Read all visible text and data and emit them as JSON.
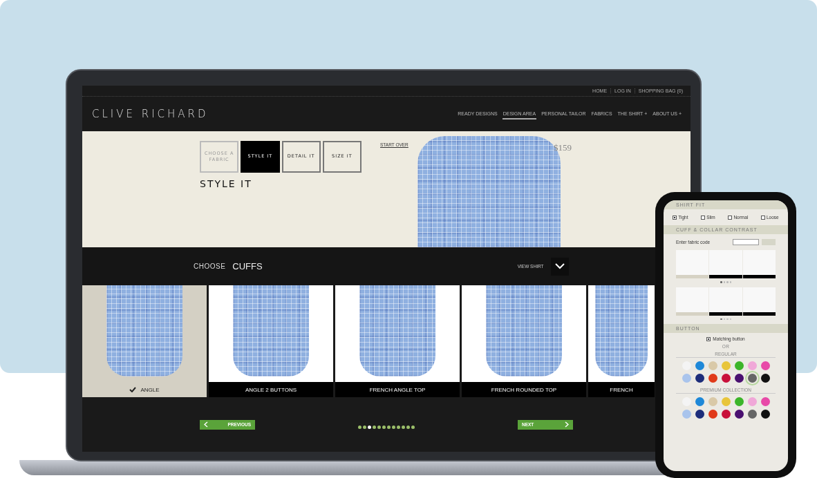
{
  "laptop": {
    "top_links": [
      "HOME",
      "LOG IN",
      "SHOPPING BAG (0)"
    ],
    "logo": "CLIVE RICHARD",
    "nav": [
      {
        "label": "READY DESIGNS",
        "selected": false
      },
      {
        "label": "DESIGN AREA",
        "selected": true
      },
      {
        "label": "PERSONAL TAILOR",
        "selected": false
      },
      {
        "label": "FABRICS",
        "selected": false
      },
      {
        "label": "THE SHIRT +",
        "selected": false
      },
      {
        "label": "ABOUT US +",
        "selected": false
      }
    ],
    "steps": [
      {
        "label": "CHOOSE A FABRIC",
        "selected": false,
        "disabled": true
      },
      {
        "label": "STYLE IT",
        "selected": true,
        "disabled": false
      },
      {
        "label": "DETAIL IT",
        "selected": false,
        "disabled": false
      },
      {
        "label": "SIZE IT",
        "selected": false,
        "disabled": false
      }
    ],
    "step_title": "STYLE IT",
    "start_over": "START OVER",
    "price": "$159",
    "choose_label": "CHOOSE",
    "choose_value": "CUFFS",
    "view_shirt": "VIEW SHIRT",
    "cuffs": [
      {
        "label": "ANGLE",
        "selected": true
      },
      {
        "label": "ANGLE 2 BUTTONS",
        "selected": false
      },
      {
        "label": "FRENCH ANGLE TOP",
        "selected": false
      },
      {
        "label": "FRENCH ROUNDED TOP",
        "selected": false
      },
      {
        "label": "FRENCH",
        "selected": false
      }
    ],
    "previous": "PREVIOUS",
    "next": "NEXT",
    "dots": [
      {
        "selected": false
      },
      {
        "selected": false
      },
      {
        "selected": true
      },
      {
        "selected": false
      },
      {
        "selected": false
      },
      {
        "selected": false
      },
      {
        "selected": false
      },
      {
        "selected": false
      },
      {
        "selected": false
      },
      {
        "selected": false
      },
      {
        "selected": false
      },
      {
        "selected": false
      }
    ]
  },
  "phone": {
    "fit_title": "SHIRT FIT",
    "fits": [
      {
        "label": "Tight",
        "checked": true
      },
      {
        "label": "Slim",
        "checked": false
      },
      {
        "label": "Normal",
        "checked": false
      },
      {
        "label": "Loose",
        "checked": false
      }
    ],
    "contrast_title": "CUFF & COLLAR CONTRAST",
    "fabric_code_label": "Enter fabric code",
    "collar_rows": [
      {
        "dots": [
          {
            "selected": true
          },
          {
            "selected": false
          },
          {
            "selected": false
          },
          {
            "selected": false
          }
        ]
      },
      {
        "dots": [
          {
            "selected": true
          },
          {
            "selected": false
          },
          {
            "selected": false
          },
          {
            "selected": false
          }
        ]
      }
    ],
    "button_title": "BUTTON",
    "matching_button": {
      "label": "Matching button",
      "checked": true
    },
    "or": "OR",
    "regular_title": "REGULAR",
    "regular": [
      {
        "color": "#f4f4f4",
        "selected": false
      },
      {
        "color": "#1e88d8",
        "selected": false
      },
      {
        "color": "#d9c9a8",
        "selected": false
      },
      {
        "color": "#e8c53a",
        "selected": false
      },
      {
        "color": "#3cb52a",
        "selected": false
      },
      {
        "color": "#f0a8d8",
        "selected": false
      },
      {
        "color": "#e84aa8",
        "selected": false
      },
      {
        "color": "#a9c4ec",
        "selected": false
      },
      {
        "color": "#1d2d7a",
        "selected": false
      },
      {
        "color": "#e03a1a",
        "selected": false
      },
      {
        "color": "#c8103a",
        "selected": false
      },
      {
        "color": "#4a1070",
        "selected": false
      },
      {
        "color": "#666666",
        "selected": true
      },
      {
        "color": "#111111",
        "selected": false
      }
    ],
    "premium_title": "PREMIUM COLLECTION",
    "premium": [
      {
        "color": "#f4f4f4",
        "selected": false
      },
      {
        "color": "#1e88d8",
        "selected": false
      },
      {
        "color": "#d9c9a8",
        "selected": false
      },
      {
        "color": "#e8c53a",
        "selected": false
      },
      {
        "color": "#3cb52a",
        "selected": false
      },
      {
        "color": "#f0a8d8",
        "selected": false
      },
      {
        "color": "#e84aa8",
        "selected": false
      },
      {
        "color": "#a9c4ec",
        "selected": false
      },
      {
        "color": "#1d2d7a",
        "selected": false
      },
      {
        "color": "#e03a1a",
        "selected": false
      },
      {
        "color": "#c8103a",
        "selected": false
      },
      {
        "color": "#4a1070",
        "selected": false
      },
      {
        "color": "#666666",
        "selected": false
      },
      {
        "color": "#111111",
        "selected": false
      }
    ]
  }
}
